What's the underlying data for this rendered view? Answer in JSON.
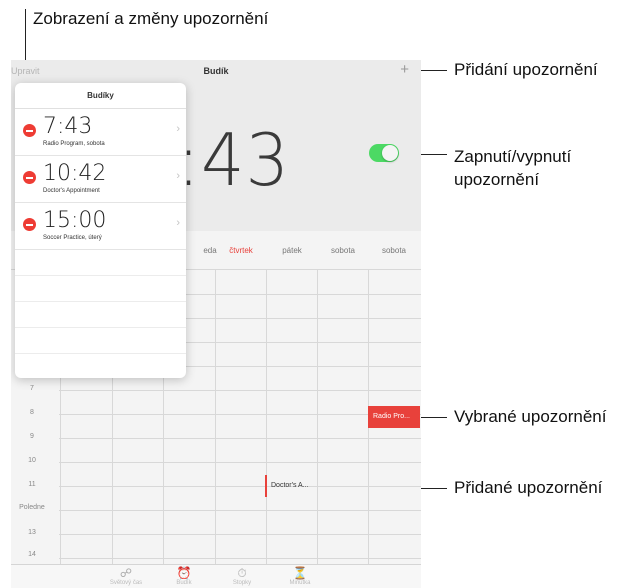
{
  "callouts": {
    "view_and_change": "Zobrazení a změny upozornění",
    "add": "Přidání upozornění",
    "toggle": [
      "Zapnutí/vypnutí",
      "upozornění"
    ],
    "selected": "Vybrané upozornění",
    "added": "Přidané upozornění"
  },
  "navbar": {
    "edit_label": "Upravit",
    "title": "Budík",
    "add_label": "+"
  },
  "alarm_time_large": ":43",
  "toggle_on": true,
  "colors": {
    "toggle": "#4cd964",
    "accent_red": "#e8413b"
  },
  "popover": {
    "title": "Budíky",
    "alarms": [
      {
        "time": "7:43",
        "label": "Radio Program, sobota"
      },
      {
        "time": "10:42",
        "label": "Doctor's Appointment"
      },
      {
        "time": "15:00",
        "label": "Soccer Practice, úterý"
      }
    ]
  },
  "calendar": {
    "days": [
      "eda",
      "čtvrtek",
      "pátek",
      "sobota",
      "sobota"
    ],
    "today_index": 1,
    "hours": [
      "7",
      "8",
      "9",
      "10",
      "11",
      "Poledne",
      "13",
      "14"
    ],
    "events": {
      "radio": "Radio Pro...",
      "doctor": "Doctor's A..."
    }
  },
  "tabbar": [
    {
      "icon": "globe-icon",
      "label": "Světový čas"
    },
    {
      "icon": "alarm-clock-icon",
      "label": "Budík"
    },
    {
      "icon": "stopwatch-icon",
      "label": "Stopky"
    },
    {
      "icon": "timer-icon",
      "label": "Minutka"
    }
  ]
}
